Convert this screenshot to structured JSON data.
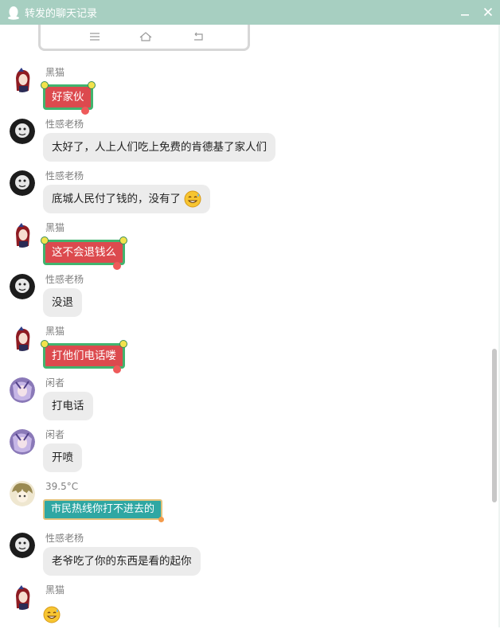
{
  "window": {
    "title": "转发的聊天记录"
  },
  "messages": [
    {
      "sender": "黑猫",
      "text": "好家伙",
      "style": "red"
    },
    {
      "sender": "性感老杨",
      "text": "太好了，人上人们吃上免费的肯德基了家人们",
      "style": "gray"
    },
    {
      "sender": "性感老杨",
      "text": "底城人民付了钱的，没有了",
      "emoji": "sweat-smile-emoji",
      "style": "gray"
    },
    {
      "sender": "黑猫",
      "text": "这不会退钱么",
      "style": "red"
    },
    {
      "sender": "性感老杨",
      "text": "没退",
      "style": "gray"
    },
    {
      "sender": "黑猫",
      "text": "打他们电话喽",
      "style": "red"
    },
    {
      "sender": "闲者",
      "text": "打电话",
      "style": "gray"
    },
    {
      "sender": "闲者",
      "text": "开喷",
      "style": "gray"
    },
    {
      "sender": "39.5°C",
      "text": "市民热线你打不进去的",
      "style": "teal"
    },
    {
      "sender": "性感老杨",
      "text": "老爷吃了你的东西是看的起你",
      "style": "gray"
    },
    {
      "sender": "黑猫",
      "text": "",
      "emoji": "sweat-smile-emoji",
      "style": "plain"
    }
  ],
  "colors": {
    "titlebar": "#a7cfc1",
    "gray_bubble": "#ececec",
    "red_bubble": "#dc4a4e",
    "red_bubble_border": "#41b46e",
    "teal_bubble": "#2fa7a3",
    "scrollbar": "#c7c7c7"
  }
}
